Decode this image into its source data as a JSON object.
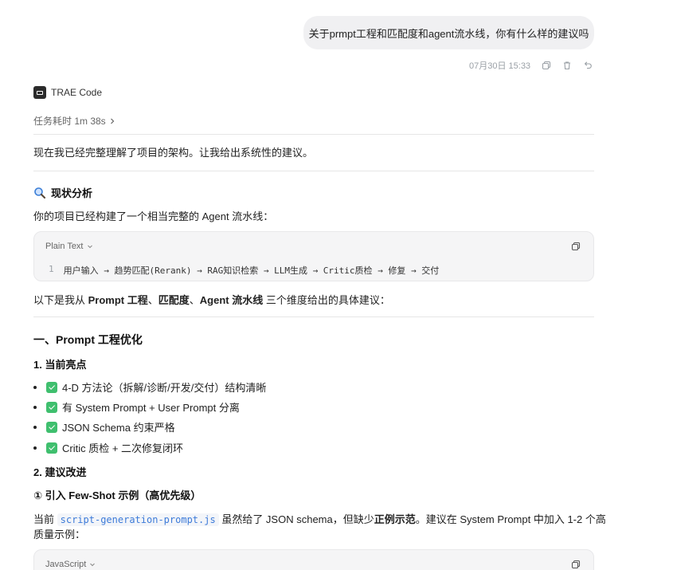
{
  "user_message": {
    "text": "关于prmpt工程和匹配度和agent流水线，你有什么样的建议吗",
    "timestamp": "07月30日 15:33"
  },
  "agent": {
    "name": "TRAE Code",
    "elapsed": "任务耗时 1m 38s"
  },
  "content": {
    "intro": "现在我已经完整理解了项目的架构。让我给出系统性的建议。",
    "section_status": {
      "icon": "magnifier-icon",
      "title": "现状分析",
      "desc": "你的项目已经构建了一个相当完整的 Agent 流水线："
    },
    "code1": {
      "lang": "Plain Text",
      "line_no": "1",
      "line": "用户输入 → 趋势匹配(Rerank) → RAG知识检索 → LLM生成 → Critic质检 → 修复 → 交付"
    },
    "dims_prefix": "以下是我从 ",
    "dims_b1": "Prompt 工程",
    "dims_sep1": "、",
    "dims_b2": "匹配度",
    "dims_sep2": "、",
    "dims_b3": "Agent 流水线",
    "dims_suffix": " 三个维度给出的具体建议：",
    "section1_title": "一、Prompt 工程优化",
    "sub1_title": "1. 当前亮点",
    "highlights": [
      "4-D 方法论（拆解/诊断/开发/交付）结构清晰",
      "有 System Prompt + User Prompt 分离",
      "JSON Schema 约束严格",
      "Critic 质检 + 二次修复闭环"
    ],
    "sub2_title": "2. 建议改进",
    "sub2_item": "① 引入 Few-Shot 示例（高优先级）",
    "p_pre": "当前 ",
    "p_code": "script-generation-prompt.js",
    "p_mid": " 虽然给了 JSON schema，但缺少",
    "p_bold": "正例示范",
    "p_post": "。建议在 System Prompt 中加入 1-2 个高",
    "p_line2": "质量示例：",
    "code2": {
      "lang": "JavaScript"
    }
  }
}
